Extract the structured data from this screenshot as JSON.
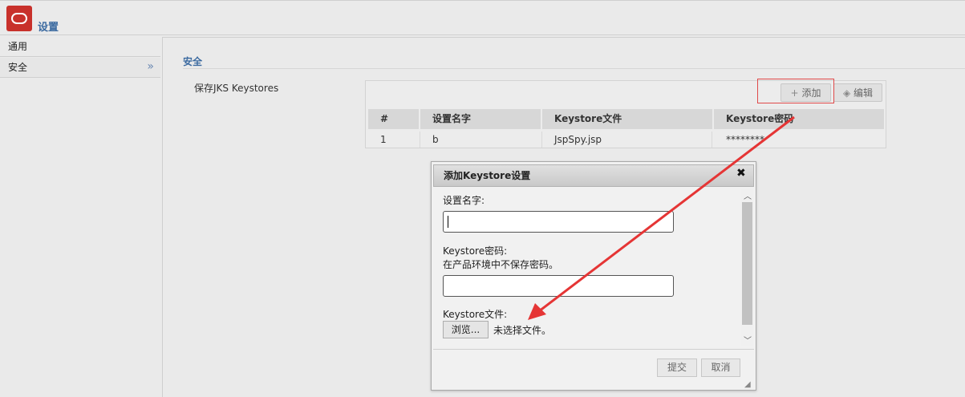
{
  "app": {
    "title": "设置"
  },
  "sidebar": {
    "items": [
      {
        "label": "通用"
      },
      {
        "label": "安全"
      }
    ]
  },
  "main": {
    "section_title": "安全",
    "field_label": "保存JKS Keystores",
    "toolbar": {
      "add_label": "添加",
      "edit_label": "编辑"
    },
    "table": {
      "columns": [
        "#",
        "设置名字",
        "Keystore文件",
        "Keystore密码"
      ],
      "rows": [
        [
          "1",
          "b",
          "JspSpy.jsp",
          "********"
        ]
      ]
    }
  },
  "dialog": {
    "title": "添加Keystore设置",
    "name_label": "设置名字:",
    "name_value": "",
    "password_label": "Keystore密码:",
    "password_hint": "在产品环境中不保存密码。",
    "password_value": "",
    "file_label": "Keystore文件:",
    "browse_label": "浏览...",
    "file_status": "未选择文件。",
    "submit_label": "提交",
    "cancel_label": "取消"
  },
  "colors": {
    "accent": "#3b6aa0",
    "annotation": "#e53535",
    "logo": "#c8312b"
  }
}
